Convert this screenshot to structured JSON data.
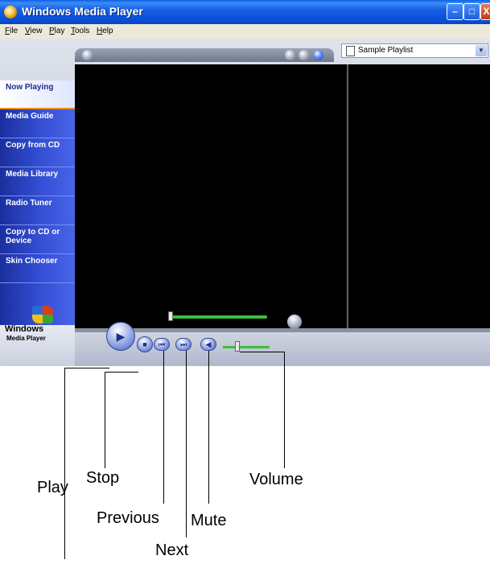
{
  "window": {
    "title": "Windows Media Player",
    "controls": {
      "minimize": "–",
      "maximize": "□",
      "close": "X"
    }
  },
  "menu": [
    "File",
    "View",
    "Play",
    "Tools",
    "Help"
  ],
  "playlist": {
    "selected": "Sample Playlist"
  },
  "taskbar": [
    {
      "label": "Now Playing",
      "active": true
    },
    {
      "label": "Media Guide"
    },
    {
      "label": "Copy from CD"
    },
    {
      "label": "Media Library"
    },
    {
      "label": "Radio Tuner"
    },
    {
      "label": "Copy to CD or Device"
    },
    {
      "label": "Skin Chooser"
    }
  ],
  "logo": {
    "text": "Windows",
    "sub": "Media Player"
  },
  "icons": {
    "play": "play-icon",
    "stop": "stop-icon",
    "previous": "previous-icon",
    "next": "next-icon",
    "mute": "mute-icon"
  },
  "callouts": {
    "play": "Play",
    "stop": "Stop",
    "previous": "Previous",
    "next": "Next",
    "mute": "Mute",
    "volume": "Volume"
  },
  "colors": {
    "title_bar": "#0a5fe3",
    "taskbar": "#3550d6",
    "seek_bar": "#3bbf3b"
  }
}
